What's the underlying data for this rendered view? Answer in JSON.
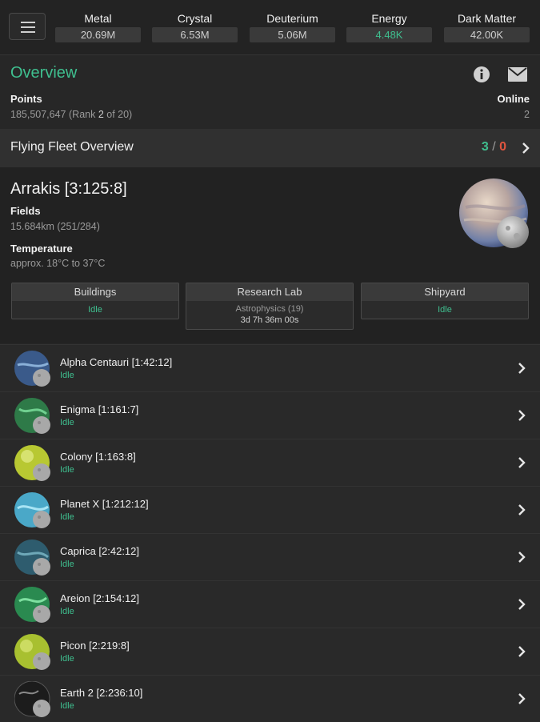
{
  "resources": [
    {
      "name": "Metal",
      "value": "20.69M"
    },
    {
      "name": "Crystal",
      "value": "6.53M"
    },
    {
      "name": "Deuterium",
      "value": "5.06M"
    },
    {
      "name": "Energy",
      "value": "4.48K"
    },
    {
      "name": "Dark Matter",
      "value": "42.00K"
    }
  ],
  "overview": {
    "title": "Overview",
    "points_label": "Points",
    "points_value": "185,507,647",
    "rank_open": "(Rank ",
    "rank_num": "2",
    "rank_close": " of 20)",
    "online_label": "Online",
    "online_value": "2"
  },
  "fleet": {
    "title": "Flying Fleet Overview",
    "own": "3",
    "sep": "/",
    "hostile": "0"
  },
  "planet": {
    "name": "Arrakis [3:125:8]",
    "fields_label": "Fields",
    "fields_value": "15.684km (251/284)",
    "temp_label": "Temperature",
    "temp_value": "approx. 18°C to 37°C",
    "queues": [
      {
        "title": "Buildings",
        "status": "Idle"
      },
      {
        "title": "Research Lab",
        "item": "Astrophysics (19)",
        "time": "3d 7h 36m 00s"
      },
      {
        "title": "Shipyard",
        "status": "Idle"
      }
    ]
  },
  "planets": [
    {
      "name": "Alpha Centauri [1:42:12]",
      "status": "Idle"
    },
    {
      "name": "Enigma [1:161:7]",
      "status": "Idle"
    },
    {
      "name": "Colony [1:163:8]",
      "status": "Idle"
    },
    {
      "name": "Planet X [1:212:12]",
      "status": "Idle"
    },
    {
      "name": "Caprica [2:42:12]",
      "status": "Idle"
    },
    {
      "name": "Areion [2:154:12]",
      "status": "Idle"
    },
    {
      "name": "Picon [2:219:8]",
      "status": "Idle"
    },
    {
      "name": "Earth 2 [2:236:10]",
      "status": "Idle"
    }
  ],
  "colors": {
    "accent": "#3fbf8f",
    "alert": "#e0553f",
    "background": "#272727"
  }
}
